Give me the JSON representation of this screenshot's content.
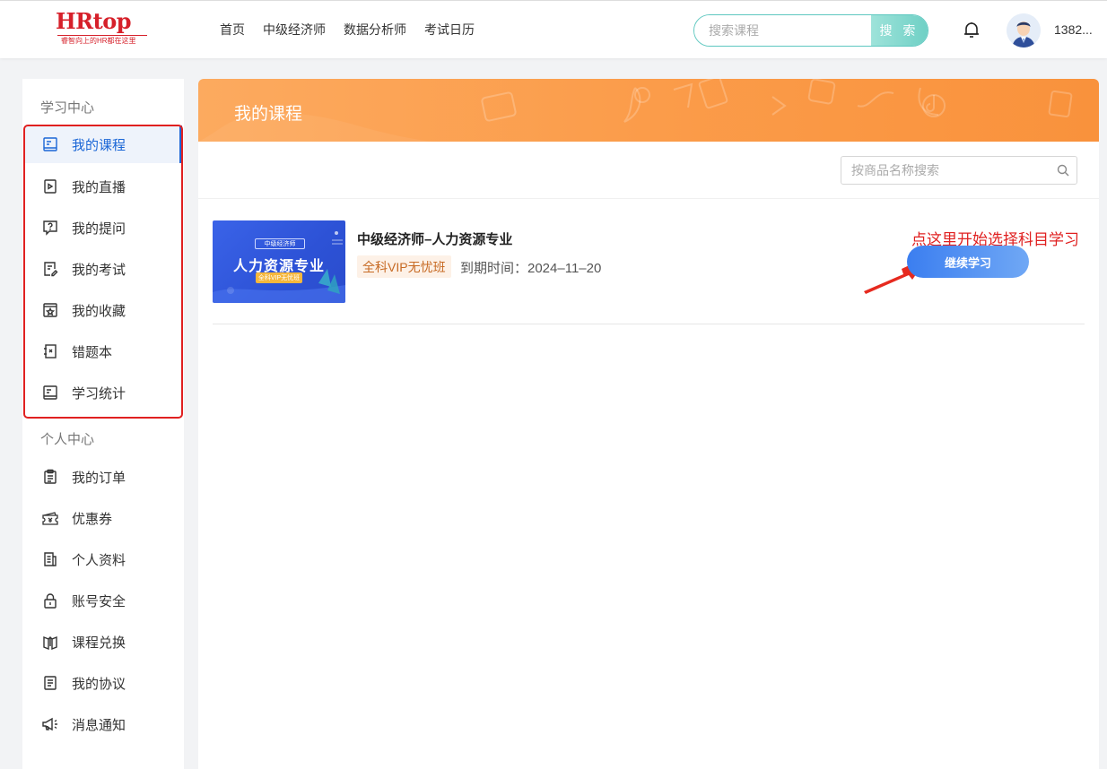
{
  "header": {
    "logo_text_hr": "HR",
    "logo_text_top": "top",
    "logo_tagline": "睿智向上的HR都在这里",
    "nav": [
      "首页",
      "中级经济师",
      "数据分析师",
      "考试日历"
    ],
    "search_placeholder": "搜索课程",
    "search_button": "搜 索",
    "username": "1382..."
  },
  "sidebar": {
    "section_study": "学习中心",
    "study_items": [
      {
        "label": "我的课程",
        "icon": "book-icon",
        "active": true
      },
      {
        "label": "我的直播",
        "icon": "live-icon"
      },
      {
        "label": "我的提问",
        "icon": "question-icon"
      },
      {
        "label": "我的考试",
        "icon": "exam-icon"
      },
      {
        "label": "我的收藏",
        "icon": "favorite-icon"
      },
      {
        "label": "错题本",
        "icon": "wrong-book-icon"
      },
      {
        "label": "学习统计",
        "icon": "stats-icon"
      }
    ],
    "section_personal": "个人中心",
    "personal_items": [
      {
        "label": "我的订单",
        "icon": "order-icon"
      },
      {
        "label": "优惠券",
        "icon": "coupon-icon"
      },
      {
        "label": "个人资料",
        "icon": "profile-icon"
      },
      {
        "label": "账号安全",
        "icon": "lock-icon"
      },
      {
        "label": "课程兑换",
        "icon": "exchange-icon"
      },
      {
        "label": "我的协议",
        "icon": "agreement-icon"
      },
      {
        "label": "消息通知",
        "icon": "megaphone-icon"
      }
    ]
  },
  "main": {
    "banner_title": "我的课程",
    "search_placeholder": "按商品名称搜索",
    "course": {
      "thumb_tag": "中级经济师",
      "thumb_title": "人力资源专业",
      "thumb_badge": "全科VIP无忧班",
      "title": "中级经济师–人力资源专业",
      "tag": "全科VIP无忧班",
      "expiry": "到期时间：2024–11–20",
      "button": "继续学习"
    },
    "annotation": "点这里开始选择科目学习"
  },
  "colors": {
    "accent_blue": "#1a66d6",
    "banner_orange": "#fb9c4a",
    "annotation_red": "#e02020",
    "search_teal": "#5ec8c0"
  }
}
